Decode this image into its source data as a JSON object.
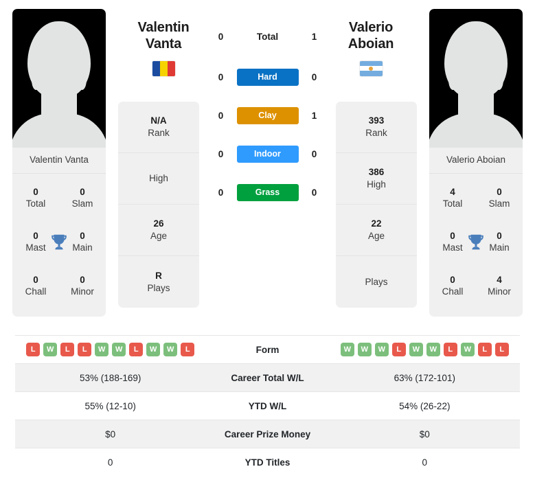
{
  "colors": {
    "hard": "#0a72c4",
    "clay": "#dd9100",
    "indoor": "#2f9bff",
    "grass": "#00a03e",
    "win": "#7cbf7c",
    "loss": "#e8594c",
    "trophy": "#4a7ebb",
    "panel": "#f0f0f0"
  },
  "players": {
    "left": {
      "first_name": "Valentin",
      "last_name": "Vanta",
      "full_name": "Valentin Vanta",
      "flag": "romania-flag",
      "avatar": "player-avatar-placeholder",
      "titles": [
        {
          "value": "0",
          "label": "Total"
        },
        {
          "value": "0",
          "label": "Slam"
        },
        {
          "value": "0",
          "label": "Mast"
        },
        {
          "value": "0",
          "label": "Main"
        },
        {
          "value": "0",
          "label": "Chall"
        },
        {
          "value": "0",
          "label": "Minor"
        }
      ],
      "info": [
        {
          "value": "N/A",
          "label": "Rank"
        },
        {
          "value": "",
          "label": "High"
        },
        {
          "value": "26",
          "label": "Age"
        },
        {
          "value": "R",
          "label": "Plays"
        }
      ],
      "form": [
        "L",
        "W",
        "L",
        "L",
        "W",
        "W",
        "L",
        "W",
        "W",
        "L"
      ],
      "career_total_wl": "53% (188-169)",
      "ytd_wl": "55% (12-10)",
      "career_prize_money": "$0",
      "ytd_titles": "0"
    },
    "right": {
      "first_name": "Valerio",
      "last_name": "Aboian",
      "full_name": "Valerio Aboian",
      "flag": "argentina-flag",
      "avatar": "player-avatar-placeholder",
      "titles": [
        {
          "value": "4",
          "label": "Total"
        },
        {
          "value": "0",
          "label": "Slam"
        },
        {
          "value": "0",
          "label": "Mast"
        },
        {
          "value": "0",
          "label": "Main"
        },
        {
          "value": "0",
          "label": "Chall"
        },
        {
          "value": "4",
          "label": "Minor"
        }
      ],
      "info": [
        {
          "value": "393",
          "label": "Rank"
        },
        {
          "value": "386",
          "label": "High"
        },
        {
          "value": "22",
          "label": "Age"
        },
        {
          "value": "",
          "label": "Plays"
        }
      ],
      "form": [
        "W",
        "W",
        "W",
        "L",
        "W",
        "W",
        "L",
        "W",
        "L",
        "L"
      ],
      "career_total_wl": "63% (172-101)",
      "ytd_wl": "54% (26-22)",
      "career_prize_money": "$0",
      "ytd_titles": "0"
    }
  },
  "head2head": [
    {
      "label": "Total",
      "left": "0",
      "right": "1",
      "style": "plain",
      "color": ""
    },
    {
      "label": "Hard",
      "left": "0",
      "right": "0",
      "style": "pill",
      "color": "#0a72c4"
    },
    {
      "label": "Clay",
      "left": "0",
      "right": "1",
      "style": "pill",
      "color": "#dd9100"
    },
    {
      "label": "Indoor",
      "left": "0",
      "right": "0",
      "style": "pill",
      "color": "#2f9bff"
    },
    {
      "label": "Grass",
      "left": "0",
      "right": "0",
      "style": "pill",
      "color": "#00a03e"
    }
  ],
  "table": {
    "rows": [
      {
        "label": "Form",
        "key": "form",
        "type": "form"
      },
      {
        "label": "Career Total W/L",
        "key": "career_total_wl",
        "type": "text"
      },
      {
        "label": "YTD W/L",
        "key": "ytd_wl",
        "type": "text"
      },
      {
        "label": "Career Prize Money",
        "key": "career_prize_money",
        "type": "text"
      },
      {
        "label": "YTD Titles",
        "key": "ytd_titles",
        "type": "text"
      }
    ]
  }
}
